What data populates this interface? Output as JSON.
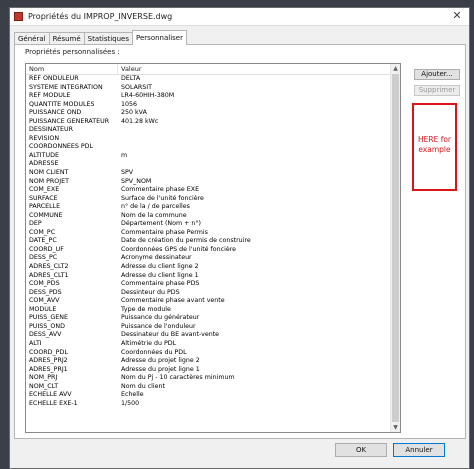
{
  "window": {
    "title": "Propriétés du IMPROP_INVERSE.dwg",
    "close_glyph": "✕"
  },
  "tabs": [
    {
      "label": "Général"
    },
    {
      "label": "Résumé"
    },
    {
      "label": "Statistiques"
    },
    {
      "label": "Personnaliser"
    }
  ],
  "panel": {
    "section_label": "Propriétés personnalisées :",
    "columns": {
      "name": "Nom",
      "value": "Valeur"
    },
    "rows": [
      {
        "name": "REF ONDULEUR",
        "value": "DELTA"
      },
      {
        "name": "SYSTEME INTEGRATION",
        "value": "SOLARSIT"
      },
      {
        "name": "REF MODULE",
        "value": "LR4-60HIH-380M"
      },
      {
        "name": "QUANTITE MODULES",
        "value": "1056"
      },
      {
        "name": "PUISSANCE OND",
        "value": "250 kVA"
      },
      {
        "name": "PUISSANCE GENERATEUR",
        "value": "401.28 kWc"
      },
      {
        "name": "DESSINATEUR",
        "value": ""
      },
      {
        "name": "REVISION",
        "value": ""
      },
      {
        "name": "COORDONNEES PDL",
        "value": ""
      },
      {
        "name": "ALTITUDE",
        "value": "m"
      },
      {
        "name": "ADRESSE",
        "value": ""
      },
      {
        "name": "NOM CLIENT",
        "value": "SPV"
      },
      {
        "name": "NOM PROJET",
        "value": "SPV_NOM"
      },
      {
        "name": "COM_EXE",
        "value": "Commentaire phase EXE"
      },
      {
        "name": "SURFACE",
        "value": "Surface de l'unité foncière"
      },
      {
        "name": "PARCELLE",
        "value": "n° de la / de parcelles"
      },
      {
        "name": "COMMUNE",
        "value": "Nom de la commune"
      },
      {
        "name": "DEP",
        "value": "Département (Nom + n°)"
      },
      {
        "name": "COM_PC",
        "value": "Commentaire phase Permis"
      },
      {
        "name": "DATE_PC",
        "value": "Date de création du permis de construire"
      },
      {
        "name": "COORD_UF",
        "value": "Coordonnées GPS de l'unité foncière"
      },
      {
        "name": "DESS_PC",
        "value": "Acronyme dessinateur"
      },
      {
        "name": "ADRES_CLT2",
        "value": "Adresse du client ligne 2"
      },
      {
        "name": "ADRES_CLT1",
        "value": "Adresse du client ligne 1"
      },
      {
        "name": "COM_PDS",
        "value": "Commentaire phase PDS"
      },
      {
        "name": "DESS_PDS",
        "value": "Dessinteur du PDS"
      },
      {
        "name": "COM_AVV",
        "value": "Commentaire phase avant vente"
      },
      {
        "name": "MODULE",
        "value": "Type de module"
      },
      {
        "name": "PUISS_GENE",
        "value": "Puissance du générateur"
      },
      {
        "name": "PUISS_OND",
        "value": "Puissance de l'onduleur"
      },
      {
        "name": "DESS_AVV",
        "value": "Dessinateur du BE avant-vente"
      },
      {
        "name": "ALTI",
        "value": "Altimétrie du PDL"
      },
      {
        "name": "COORD_PDL",
        "value": "Coordonnées du PDL"
      },
      {
        "name": "ADRES_PRJ2",
        "value": "Adresse du projet ligne 2"
      },
      {
        "name": "ADRES_PRJ1",
        "value": "Adresse du projet ligne 1"
      },
      {
        "name": "NOM_PRJ",
        "value": "Nom du Pj - 10 caractères minimum"
      },
      {
        "name": "NOM_CLT",
        "value": "Nom du client"
      },
      {
        "name": "ECHELLE AVV",
        "value": "Echelle"
      },
      {
        "name": "ECHELLE EXE-1",
        "value": "1/500"
      }
    ]
  },
  "buttons": {
    "add": "Ajouter...",
    "delete": "Supprimer",
    "ok": "OK",
    "cancel": "Annuler"
  },
  "annotation": {
    "text": "HERE for example",
    "color": "#d9151b"
  }
}
